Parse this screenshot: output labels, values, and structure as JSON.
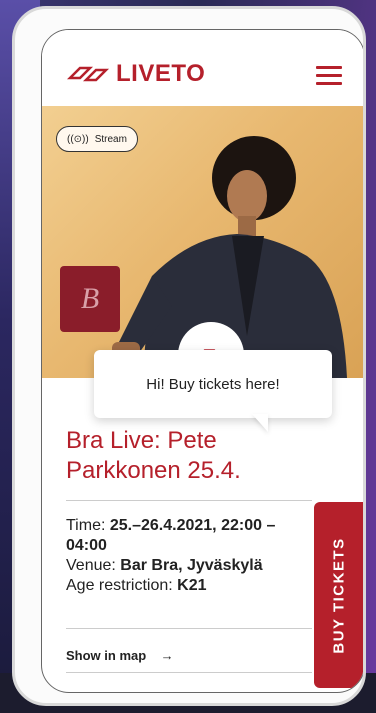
{
  "brand": {
    "name": "LIVETO",
    "accent": "#b5202b"
  },
  "hero": {
    "badge_label": "Stream",
    "badge_icon": "broadcast-icon"
  },
  "bubble": {
    "text": "Hi! Buy tickets here!"
  },
  "event": {
    "title": "Bra Live: Pete Parkkonen 25.4.",
    "time_label": "Time:",
    "time_value": "25.–26.4.2021, 22:00 – 04:00",
    "venue_label": "Venue:",
    "venue_value": "Bar Bra, Jyväskylä",
    "age_label": "Age restriction:",
    "age_value": "K21"
  },
  "actions": {
    "map_label": "Show in map",
    "map_arrow": "→",
    "buy_label": "BUY TICKETS"
  }
}
